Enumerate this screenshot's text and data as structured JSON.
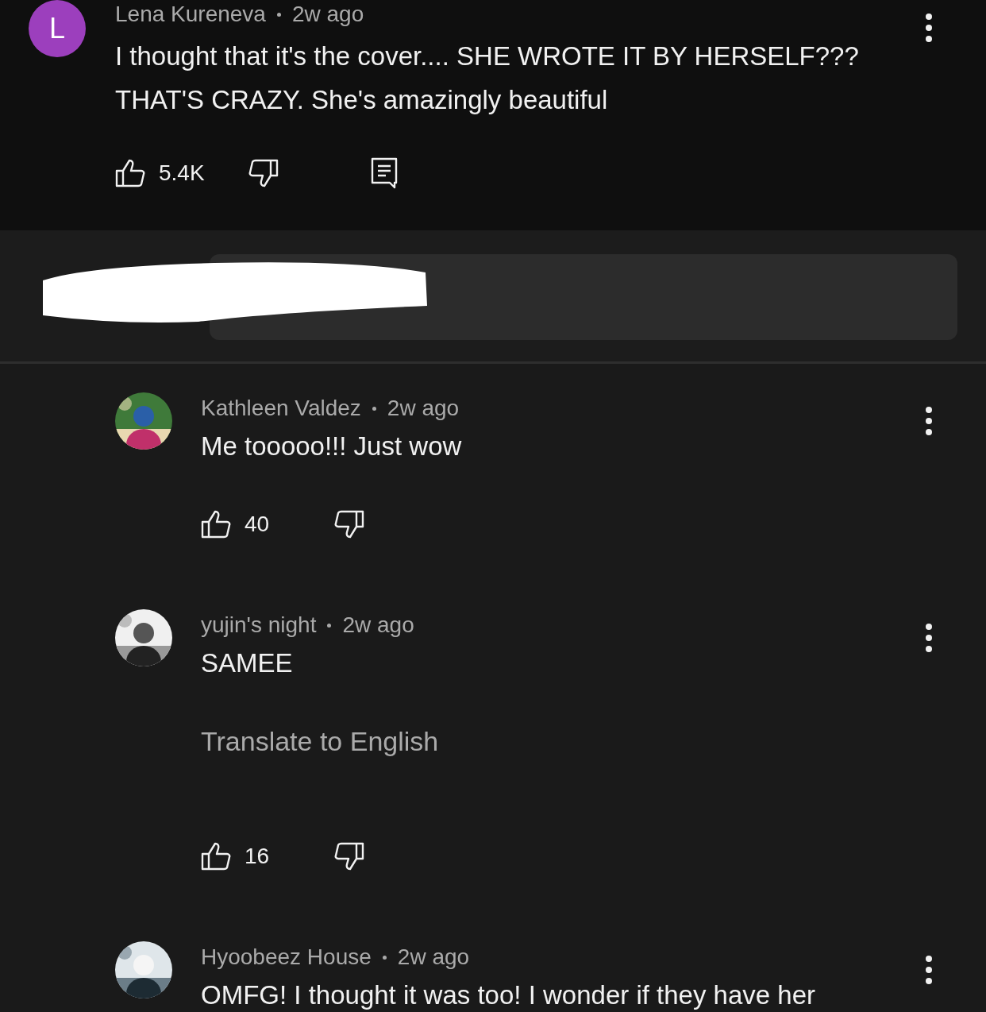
{
  "comment": {
    "avatar_letter": "L",
    "author": "Lena Kureneva",
    "time": "2w ago",
    "text": "I thought that it's the cover.... SHE WROTE IT BY HERSELF??? THAT'S CRAZY. She's amazingly beautiful",
    "likes": "5.4K"
  },
  "reply_box": {
    "redacted": true
  },
  "replies": [
    {
      "author": "Kathleen Valdez",
      "time": "2w ago",
      "text": "Me tooooo!!! Just wow",
      "likes": "40"
    },
    {
      "author": "yujin's night",
      "time": "2w ago",
      "text": "SAMEE",
      "translate": "Translate to English",
      "likes": "16"
    },
    {
      "author": "Hyoobeez House",
      "time": "2w ago",
      "text": "OMFG! I thought it was too! I wonder if they have her"
    }
  ]
}
